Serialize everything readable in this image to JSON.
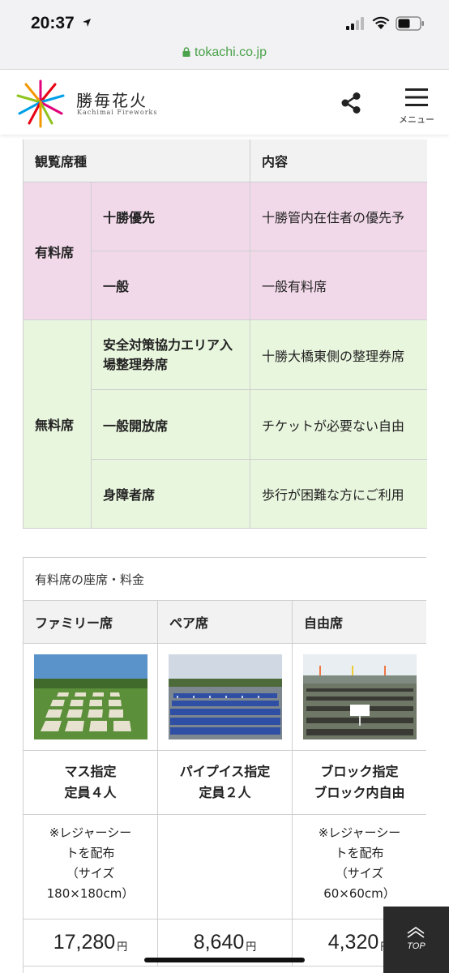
{
  "status_bar": {
    "time": "20:37"
  },
  "browser": {
    "url": "tokachi.co.jp"
  },
  "header": {
    "logo_title": "勝毎花火",
    "logo_subtitle": "Kachimai Fireworks",
    "menu_label": "メニュー"
  },
  "seat_table": {
    "headers": [
      "観覧席種",
      "内容"
    ],
    "groups": [
      {
        "label": "有料席",
        "rows": [
          {
            "name": "十勝優先",
            "detail": "十勝管内在住者の優先予"
          },
          {
            "name": "一般",
            "detail": "一般有料席"
          }
        ]
      },
      {
        "label": "無料席",
        "rows": [
          {
            "name": "安全対策協力エリア入場整理券席",
            "detail": "十勝大橋東側の整理券席"
          },
          {
            "name": "一般開放席",
            "detail": "チケットが必要ない自由"
          },
          {
            "name": "身障者席",
            "detail": "歩行が困難な方にご利用"
          }
        ]
      }
    ]
  },
  "price_table": {
    "caption": "有料席の座席・料金",
    "columns": [
      {
        "name": "ファミリー席",
        "type_line1": "マス指定",
        "type_line2": "定員４人",
        "note": [
          "※レジャーシー",
          "トを配布",
          "（サイズ",
          "180×180cm）"
        ],
        "price": "17,280",
        "unit": "円"
      },
      {
        "name": "ペア席",
        "type_line1": "パイプイス指定",
        "type_line2": "定員２人",
        "note": [],
        "price": "8,640",
        "unit": "円"
      },
      {
        "name": "自由席",
        "type_line1": "ブロック指定",
        "type_line2": "ブロック内自由",
        "note": [
          "※レジャーシー",
          "トを配布",
          "（サイズ",
          "60×60cm）"
        ],
        "price": "4,320",
        "unit": "円"
      }
    ]
  },
  "top_button": {
    "label": "TOP"
  },
  "colors": {
    "paid_row": "#f2d9ea",
    "free_row": "#e9f6de",
    "header_row": "#f2f2f2",
    "url_green": "#4aa24a"
  },
  "icons": [
    "location-arrow-icon",
    "signal-icon",
    "wifi-icon",
    "battery-icon",
    "lock-icon",
    "share-icon",
    "hamburger-icon",
    "chevron-up-icon"
  ]
}
